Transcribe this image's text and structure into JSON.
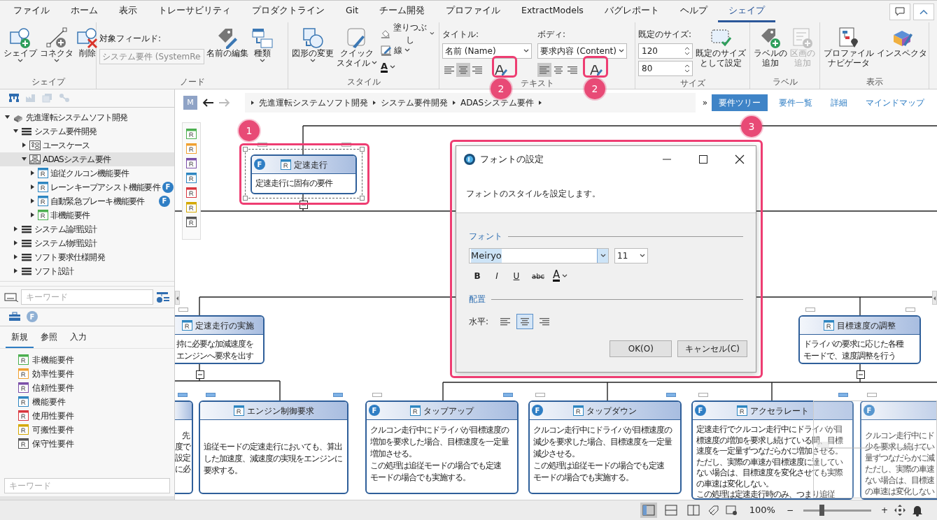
{
  "menu_tabs": [
    {
      "label": "ファイル",
      "selected": false
    },
    {
      "label": "ホーム",
      "selected": false
    },
    {
      "label": "表示",
      "selected": false
    },
    {
      "label": "トレーサビリティ",
      "selected": false
    },
    {
      "label": "プロダクトライン",
      "selected": false
    },
    {
      "label": "Git",
      "selected": false
    },
    {
      "label": "チーム開発",
      "selected": false
    },
    {
      "label": "プロファイル",
      "selected": false
    },
    {
      "label": "ExtractModels",
      "selected": false
    },
    {
      "label": "バグレポート",
      "selected": false
    },
    {
      "label": "ヘルプ",
      "selected": false
    },
    {
      "label": "シェイプ",
      "selected": true
    }
  ],
  "ribbon_groups": [
    {
      "title": "シェイプ",
      "controls": [
        {
          "kind": "large",
          "label": "シェイプ",
          "dropdown": true
        },
        {
          "kind": "large",
          "label": "コネクタ",
          "dropdown": true
        },
        {
          "kind": "large",
          "label": "削除",
          "dropdown": false
        }
      ]
    },
    {
      "title": "ノード",
      "controls": [
        {
          "kind": "field",
          "label": "対象フィールド:",
          "value": "システム要件 (SystemRe",
          "disabled": true
        },
        {
          "kind": "large",
          "label": "名前の編集",
          "dropdown": false
        },
        {
          "kind": "large",
          "label": "種類",
          "dropdown": true
        }
      ]
    },
    {
      "title": "スタイル",
      "controls": [
        {
          "kind": "large",
          "label": "図形の変更",
          "dropdown": true
        },
        {
          "kind": "large",
          "lines": [
            "クイック",
            "スタイル"
          ],
          "dropdown": true
        },
        {
          "kind": "stack",
          "items": [
            {
              "kind": "fill",
              "label": "塗りつぶし"
            },
            {
              "kind": "line",
              "label": "線"
            },
            {
              "kind": "fontcolor",
              "label": "A"
            }
          ]
        }
      ]
    },
    {
      "title": "テキスト",
      "controls": [
        {
          "kind": "textformat",
          "label": "タイトル:",
          "value": "名前 (Name)",
          "align": [
            {
              "selected": false
            },
            {
              "selected": true
            },
            {
              "selected": false
            }
          ]
        },
        {
          "kind": "textformat",
          "label": "ボディ:",
          "value": "要求内容 (Content)",
          "align": [
            {
              "selected": true
            },
            {
              "selected": false
            },
            {
              "selected": false
            }
          ]
        }
      ]
    },
    {
      "title": "サイズ",
      "controls": [
        {
          "kind": "size",
          "label": "既定のサイズ:",
          "values": [
            "120",
            "80"
          ]
        },
        {
          "kind": "large",
          "lines": [
            "既定のサイズ",
            "として設定"
          ],
          "dropdown": false
        }
      ]
    },
    {
      "title": "ラベル",
      "controls": [
        {
          "kind": "large",
          "lines": [
            "ラベルの",
            "追加"
          ],
          "dropdown": false,
          "disabled": false
        },
        {
          "kind": "large",
          "lines": [
            "区画の",
            "追加"
          ],
          "dropdown": false,
          "disabled": true
        }
      ]
    },
    {
      "title": "表示",
      "controls": [
        {
          "kind": "large",
          "lines": [
            "プロファイル",
            "ナビゲータ"
          ],
          "dropdown": false
        },
        {
          "kind": "large",
          "label": "インスペクタ",
          "dropdown": false
        }
      ]
    }
  ],
  "callouts": [
    {
      "label": "1"
    },
    {
      "label": "2"
    },
    {
      "label": "2"
    },
    {
      "label": "3"
    }
  ],
  "tree": [
    {
      "label": "先進運転システムソフト開発",
      "kind": "project",
      "expanded": true,
      "selected": false,
      "children": [
        {
          "label": "システム要件開発",
          "kind": "package",
          "expanded": true,
          "selected": false,
          "children": [
            {
              "label": "ユースケース",
              "kind": "usecase",
              "expanded": false,
              "selected": false
            },
            {
              "label": "ADASシステム要件",
              "kind": "diagram",
              "expanded": true,
              "selected": true,
              "children": [
                {
                  "label": "追従クルコン機能要件",
                  "kind": "req",
                  "color": "#2e86c1",
                  "expanded": false,
                  "selected": false
                },
                {
                  "label": "レーンキープアシスト機能要件",
                  "kind": "req",
                  "color": "#2e86c1",
                  "expanded": false,
                  "selected": false,
                  "badge": "F"
                },
                {
                  "label": "自動緊急ブレーキ機能要件",
                  "kind": "req",
                  "color": "#2e86c1",
                  "expanded": false,
                  "selected": false,
                  "badge": "F"
                },
                {
                  "label": "非機能要件",
                  "kind": "req",
                  "color": "#4caf50",
                  "expanded": false,
                  "selected": false
                }
              ]
            }
          ]
        },
        {
          "label": "システム論理設計",
          "kind": "package",
          "expanded": false,
          "selected": false
        },
        {
          "label": "システム物理設計",
          "kind": "package",
          "expanded": false,
          "selected": false
        },
        {
          "label": "ソフト要求仕様開発",
          "kind": "package",
          "expanded": false,
          "selected": false
        },
        {
          "label": "ソフト設計",
          "kind": "package",
          "expanded": false,
          "selected": false
        }
      ]
    }
  ],
  "tree_search": {
    "placeholder": "キーワード"
  },
  "toolbox": {
    "badge": "F",
    "tabs": [
      {
        "label": "新規",
        "selected": true
      },
      {
        "label": "参照",
        "selected": false
      },
      {
        "label": "入力",
        "selected": false
      }
    ],
    "items": [
      {
        "label": "非機能要件",
        "color": "#4caf50"
      },
      {
        "label": "効率性要件",
        "color": "#f0a030"
      },
      {
        "label": "信頼性要件",
        "color": "#7b4fa8"
      },
      {
        "label": "機能要件",
        "color": "#2e86c1"
      },
      {
        "label": "使用性要件",
        "color": "#d9363e"
      },
      {
        "label": "可搬性要件",
        "color": "#d4a800"
      },
      {
        "label": "保守性要件",
        "color": "#555555"
      }
    ],
    "search": {
      "placeholder": "キーワード"
    }
  },
  "canvas": {
    "avatar": "M",
    "breadcrumb": [
      "先進運転システムソフト開発",
      "システム要件開発",
      "ADASシステム要件"
    ],
    "overflow": "»",
    "views": [
      {
        "label": "要件ツリー",
        "selected": true
      },
      {
        "label": "要件一覧",
        "selected": false
      },
      {
        "label": "詳細",
        "selected": false
      },
      {
        "label": "マインドマップ",
        "selected": false
      }
    ],
    "palette": [
      {
        "color": "#4caf50"
      },
      {
        "color": "#f0a030"
      },
      {
        "color": "#7b4fa8"
      },
      {
        "color": "#2e86c1"
      },
      {
        "color": "#d9363e"
      },
      {
        "color": "#d4a800"
      },
      {
        "color": "#555555"
      }
    ],
    "nodes": [
      {
        "title": "定速走行",
        "badge": "F",
        "body": [
          "定速走行に固有の要件"
        ],
        "selected": true,
        "expanded": true,
        "ports": [
          {
            "filled": false
          },
          {
            "filled": false
          }
        ]
      },
      {
        "title": "定速走行の実施",
        "body": [
          "持に必要な加減速度を",
          "エンジンへ要求を出す"
        ],
        "selected": false,
        "expanded": true,
        "ports": [
          {
            "filled": false
          }
        ]
      },
      {
        "title": "目標速度の調整",
        "body": [
          "ドライバの要求に応じた各種",
          "モードで、速度調整を行う"
        ],
        "selected": false,
        "expanded": true,
        "ports": [
          {
            "filled": false
          },
          {
            "filled": false
          }
        ]
      },
      {
        "body": [
          "先",
          "度で",
          "設定",
          "に必"
        ],
        "selected": false,
        "ports": [
          {
            "filled": true
          }
        ]
      },
      {
        "title": "エンジン制御要求",
        "body": [
          "追従モードの定速走行においても、算出",
          "した加速度、減速度の実現をエンジンに",
          "要求する。"
        ],
        "selected": false,
        "ports": [
          {
            "filled": true
          },
          {
            "filled": true
          }
        ]
      },
      {
        "title": "タップアップ",
        "badge": "F",
        "body": [
          "クルコン走行中にドライバが目標速度の",
          "増加を要求した場合、目標速度を一定量",
          "増加させる。",
          "この処理は追従モードの場合でも定速",
          "モードの場合でも実施する。"
        ],
        "selected": false,
        "ports": [
          {
            "filled": false
          },
          {
            "filled": true
          }
        ]
      },
      {
        "title": "タップダウン",
        "badge": "F",
        "body": [
          "クルコン走行中にドライバが目標速度の",
          "減少を要求した場合、目標速度を一定量",
          "減少させる。",
          "この処理は追従モードの場合でも定速",
          "モードの場合でも実施する。"
        ],
        "selected": false,
        "ports": [
          {
            "filled": false
          },
          {
            "filled": true
          }
        ]
      },
      {
        "title": "アクセラレート",
        "badge": "F",
        "body": [
          "定速走行でクルコン走行中にドライバが目",
          "標速度の増加を要求し続けている間、目標",
          "速度を一定量ずつなだらかに増加させる。",
          "ただし、実際の車速が目標速度に達してい",
          "ない場合は、目標速度を変化させても実際",
          "の車速は変化しない。",
          "この処理は定速走行時のみ、つまり追従"
        ],
        "selected": false,
        "ports": [
          {
            "filled": false
          },
          {
            "filled": true
          }
        ]
      },
      {
        "badge": "F",
        "body": [
          "クルコン走行中にド",
          "少を要求し続けてい",
          "量ずつなだらかに減",
          "ただし、実際の車速",
          "ない場合は、目標速",
          "の車速は変化しない"
        ],
        "selected": false,
        "ports": [
          {
            "filled": false
          }
        ]
      }
    ]
  },
  "dialog": {
    "title": "フォントの設定",
    "description": "フォントのスタイルを設定します。",
    "font_section": "フォント",
    "font_name": "Meiryo",
    "font_size": "11",
    "styles": [
      {
        "kind": "bold",
        "label": "B"
      },
      {
        "kind": "italic",
        "label": "I"
      },
      {
        "kind": "underline",
        "label": "U"
      },
      {
        "kind": "strike",
        "label": "abc"
      }
    ],
    "color_glyph": "A",
    "align_section": "配置",
    "align_label": "水平:",
    "align": [
      {
        "selected": false
      },
      {
        "selected": true
      },
      {
        "selected": false
      }
    ],
    "buttons": [
      "OK(O)",
      "キャンセル(C)"
    ]
  },
  "status_bar": {
    "layouts": [
      {
        "selected": true
      },
      {
        "selected": false
      },
      {
        "selected": false
      }
    ],
    "zoom_label": "100%",
    "zoom_out": "−",
    "zoom_in": "+",
    "zoom": {
      "level": 0.27
    }
  }
}
